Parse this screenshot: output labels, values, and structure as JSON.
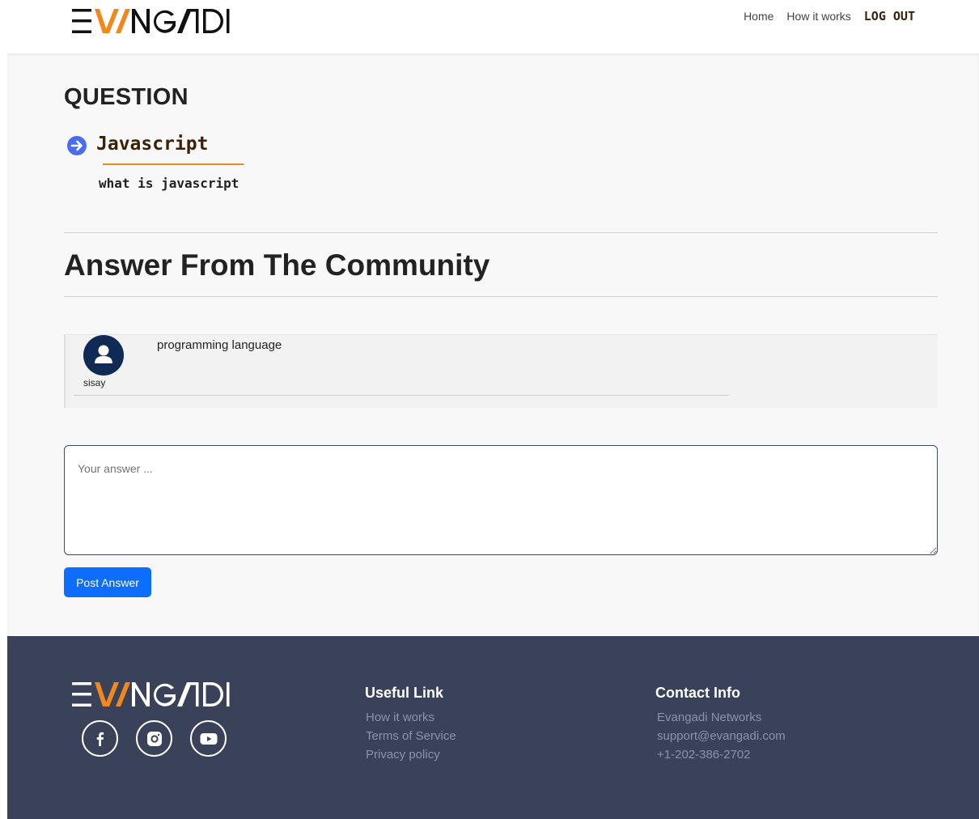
{
  "header": {
    "logo_text": "EVANGADI",
    "nav": {
      "home": "Home",
      "how_it_works": "How it works",
      "logout": "LOG OUT"
    }
  },
  "question": {
    "heading": "QUESTION",
    "topic": "Javascript",
    "body": "what is javascript"
  },
  "answers": {
    "heading": "Answer From The Community",
    "items": [
      {
        "username": "sisay",
        "text": "programming language"
      }
    ]
  },
  "answer_form": {
    "placeholder": "Your answer ...",
    "submit_label": "Post Answer"
  },
  "footer": {
    "logo_text": "EVANGADI",
    "social": [
      "facebook-icon",
      "instagram-icon",
      "youtube-icon"
    ],
    "useful_link": {
      "title": "Useful Link",
      "links": [
        "How it works",
        "Terms of Service",
        "Privacy policy"
      ]
    },
    "contact_info": {
      "title": "Contact Info",
      "lines": [
        "Evangadi Networks",
        "support@evangadi.com",
        "+1-202-386-2702"
      ]
    }
  },
  "colors": {
    "accent": "#f0881e",
    "primary": "#0d6efd",
    "footer_bg": "#3a4259",
    "avatar_bg": "#0f2a55"
  }
}
